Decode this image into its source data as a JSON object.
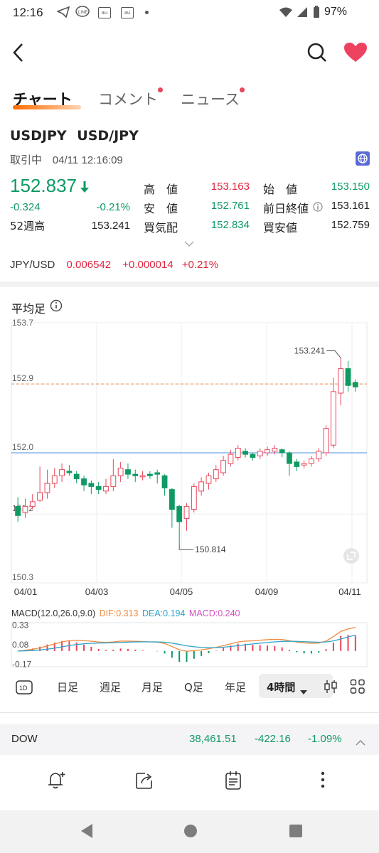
{
  "status": {
    "time": "12:16",
    "battery": "97%"
  },
  "tabs": [
    {
      "label": "チャート"
    },
    {
      "label": "コメント"
    },
    {
      "label": "ニュース"
    }
  ],
  "symbol": {
    "code": "USDJPY",
    "name": "USD/JPY",
    "state": "取引中",
    "datetime": "04/11 12:16:09"
  },
  "quote": {
    "price": "152.837",
    "change": "-0.324",
    "change_pct": "-0.21%",
    "week52_label": "52週高",
    "week52_val": "153.241",
    "high_label": "高　値",
    "high_val": "153.163",
    "low_label": "安　値",
    "low_val": "152.761",
    "bid_label": "買気配",
    "bid_val": "152.834",
    "open_label": "始　値",
    "open_val": "153.150",
    "prev_label": "前日終値",
    "prev_val": "153.161",
    "ask_label": "買安値",
    "ask_val": "152.759"
  },
  "inverse": {
    "pair": "JPY/USD",
    "price": "0.006542",
    "change": "+0.000014",
    "pct": "+0.21%"
  },
  "chart": {
    "title": "平均足",
    "yticks": [
      "153.7",
      "152.9",
      "152.0",
      "151.2",
      "150.3"
    ],
    "xticks": [
      "04/01",
      "04/03",
      "04/05",
      "04/09",
      "04/11"
    ],
    "high_label": "153.241",
    "low_label": "150.814",
    "ref_line_orange": 152.9,
    "ref_line_blue": 152.0,
    "colors": {
      "up": "#e8465a",
      "down": "#0f9a63",
      "orange": "#f08a3c",
      "blue": "#4a90e2"
    }
  },
  "macd": {
    "params": "MACD(12.0,26.0,9.0)",
    "dif": "DIF:0.313",
    "dea": "DEA:0.194",
    "macd": "MACD:0.240",
    "yticks": [
      "0.33",
      "0.08",
      "-0.17"
    ]
  },
  "periods": [
    {
      "label": "日足"
    },
    {
      "label": "週足"
    },
    {
      "label": "月足"
    },
    {
      "label": "Q足"
    },
    {
      "label": "年足"
    },
    {
      "label": "4時間"
    }
  ],
  "ticker": {
    "name": "DOW",
    "price": "38,461.51",
    "change": "-422.16",
    "pct": "-1.09%"
  },
  "chart_data": {
    "type": "candlestick",
    "title": "平均足",
    "ylim": [
      150.3,
      153.7
    ],
    "x_ticks": [
      "04/01",
      "04/03",
      "04/05",
      "04/09",
      "04/11"
    ],
    "candles": [
      [
        151.3,
        151.18,
        151.42,
        151.1
      ],
      [
        151.22,
        151.3,
        151.4,
        151.15
      ],
      [
        151.3,
        151.36,
        151.46,
        151.26
      ],
      [
        151.38,
        151.48,
        151.82,
        151.36
      ],
      [
        151.48,
        151.6,
        151.78,
        151.4
      ],
      [
        151.6,
        151.7,
        151.8,
        151.54
      ],
      [
        151.7,
        151.78,
        151.86,
        151.62
      ],
      [
        151.76,
        151.74,
        151.84,
        151.7
      ],
      [
        151.72,
        151.66,
        151.76,
        151.6
      ],
      [
        151.66,
        151.58,
        151.7,
        151.5
      ],
      [
        151.6,
        151.56,
        151.64,
        151.46
      ],
      [
        151.56,
        151.52,
        151.62,
        151.46
      ],
      [
        151.5,
        151.56,
        151.66,
        151.46
      ],
      [
        151.56,
        151.7,
        151.92,
        151.5
      ],
      [
        151.7,
        151.8,
        151.88,
        151.62
      ],
      [
        151.78,
        151.72,
        151.86,
        151.66
      ],
      [
        151.72,
        151.7,
        151.78,
        151.62
      ],
      [
        151.7,
        151.7,
        151.76,
        151.64
      ],
      [
        151.72,
        151.7,
        151.76,
        151.66
      ],
      [
        151.74,
        151.72,
        151.78,
        151.6
      ],
      [
        151.7,
        151.54,
        151.72,
        151.44
      ],
      [
        151.52,
        151.26,
        151.54,
        151.02
      ],
      [
        151.3,
        151.1,
        151.32,
        150.81
      ],
      [
        151.14,
        151.3,
        151.34,
        150.98
      ],
      [
        151.26,
        151.56,
        151.6,
        151.22
      ],
      [
        151.5,
        151.62,
        151.68,
        151.44
      ],
      [
        151.6,
        151.7,
        151.74,
        151.52
      ],
      [
        151.66,
        151.78,
        151.84,
        151.62
      ],
      [
        151.74,
        151.9,
        151.96,
        151.7
      ],
      [
        151.86,
        151.98,
        152.04,
        151.82
      ],
      [
        151.94,
        152.06,
        152.1,
        151.9
      ],
      [
        152.02,
        151.98,
        152.06,
        151.94
      ],
      [
        151.98,
        151.94,
        152.0,
        151.9
      ],
      [
        151.96,
        152.02,
        152.06,
        151.92
      ],
      [
        152.0,
        152.04,
        152.08,
        151.96
      ],
      [
        152.02,
        152.06,
        152.1,
        151.98
      ],
      [
        152.04,
        152.0,
        152.06,
        151.94
      ],
      [
        152.0,
        151.86,
        152.02,
        151.7
      ],
      [
        151.88,
        151.82,
        151.92,
        151.76
      ],
      [
        151.84,
        151.86,
        151.9,
        151.8
      ],
      [
        151.86,
        151.92,
        151.96,
        151.82
      ],
      [
        151.92,
        152.02,
        152.06,
        151.88
      ],
      [
        152.0,
        152.32,
        152.36,
        151.96
      ],
      [
        152.1,
        152.8,
        152.98,
        152.06
      ],
      [
        152.78,
        153.1,
        153.24,
        152.62
      ],
      [
        153.1,
        152.88,
        153.2,
        152.8
      ],
      [
        152.92,
        152.86,
        152.96,
        152.8
      ]
    ]
  }
}
